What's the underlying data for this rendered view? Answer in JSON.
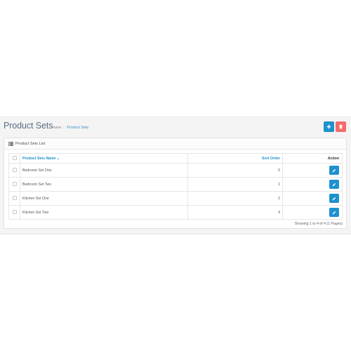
{
  "header": {
    "title": "Product Sets",
    "breadcrumb": [
      "Home",
      "Product Sets"
    ]
  },
  "buttons": {
    "add_icon": "plus-icon",
    "delete_icon": "trash-icon"
  },
  "panel": {
    "title": "Product Sets List",
    "title_icon": "list-icon"
  },
  "table": {
    "columns": {
      "name": "Product Sets Name",
      "sort_order": "Sort Order",
      "action": "Action"
    },
    "sort_indicator": "▲",
    "rows": [
      {
        "name": "Bedroom Set One",
        "sort_order": "0"
      },
      {
        "name": "Bedroom Set Two",
        "sort_order": "1"
      },
      {
        "name": "Kitchen Set One",
        "sort_order": "2"
      },
      {
        "name": "Kitchen Set Two",
        "sort_order": "4"
      }
    ]
  },
  "pagination": {
    "text": "Showing 1 to 4 of 4 (1 Pages)"
  },
  "colors": {
    "primary": "#1e91cf",
    "danger": "#f56b6b",
    "title": "#5b6f84"
  }
}
